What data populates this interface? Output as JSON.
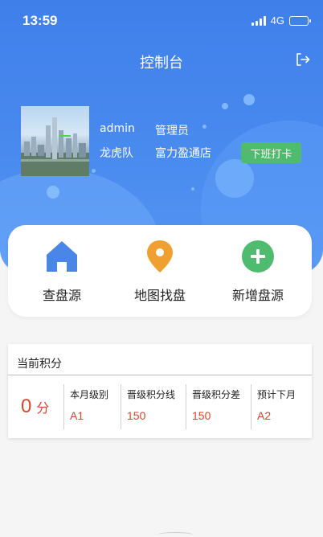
{
  "status_bar": {
    "time": "13:59",
    "network": "4G"
  },
  "header": {
    "title": "控制台"
  },
  "user": {
    "name": "admin",
    "role": "管理员",
    "team": "龙虎队",
    "store": "富力盈通店"
  },
  "checkout_button": "下班打卡",
  "actions": [
    {
      "label": "查盘源",
      "icon": "home-icon",
      "color": "#4a86e8"
    },
    {
      "label": "地图找盘",
      "icon": "map-pin-icon",
      "color": "#f0a030"
    },
    {
      "label": "新增盘源",
      "icon": "plus-circle-icon",
      "color": "#4fbb6e"
    }
  ],
  "score": {
    "title": "当前积分",
    "value": "0",
    "unit": "分",
    "columns": [
      {
        "header": "本月级别",
        "value": "A1"
      },
      {
        "header": "晋级积分线",
        "value": "150"
      },
      {
        "header": "晋级积分差",
        "value": "150"
      },
      {
        "header": "预计下月",
        "value": "A2"
      }
    ]
  },
  "colors": {
    "primary": "#3f7fea",
    "accent_red": "#d9442e",
    "green": "#4fbb6e"
  }
}
